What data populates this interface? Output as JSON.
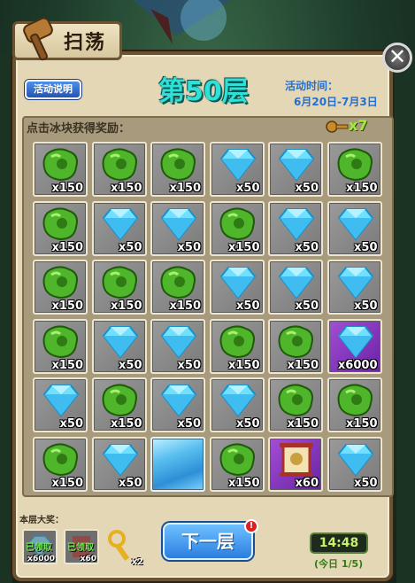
{
  "header": {
    "title": "扫荡",
    "close_label": "✕"
  },
  "info_button": "活动说明",
  "floor_title": "第50层",
  "event": {
    "label": "活动时间：",
    "dates": "6月20日-7月3日"
  },
  "instructions": "点击冰块获得奖励：",
  "keys": {
    "count": "x7"
  },
  "grid": [
    [
      {
        "type": "jade",
        "qty": "x150"
      },
      {
        "type": "jade",
        "qty": "x150"
      },
      {
        "type": "jade",
        "qty": "x150"
      },
      {
        "type": "diamond",
        "qty": "x50"
      },
      {
        "type": "diamond",
        "qty": "x50"
      },
      {
        "type": "jade",
        "qty": "x150"
      }
    ],
    [
      {
        "type": "jade",
        "qty": "x150"
      },
      {
        "type": "diamond",
        "qty": "x50"
      },
      {
        "type": "diamond",
        "qty": "x50"
      },
      {
        "type": "jade",
        "qty": "x150"
      },
      {
        "type": "diamond",
        "qty": "x50"
      },
      {
        "type": "diamond",
        "qty": "x50"
      }
    ],
    [
      {
        "type": "jade",
        "qty": "x150"
      },
      {
        "type": "jade",
        "qty": "x150"
      },
      {
        "type": "jade",
        "qty": "x150"
      },
      {
        "type": "diamond",
        "qty": "x50"
      },
      {
        "type": "diamond",
        "qty": "x50"
      },
      {
        "type": "diamond",
        "qty": "x50"
      }
    ],
    [
      {
        "type": "jade",
        "qty": "x150"
      },
      {
        "type": "diamond",
        "qty": "x50"
      },
      {
        "type": "diamond",
        "qty": "x50"
      },
      {
        "type": "jade",
        "qty": "x150"
      },
      {
        "type": "jade",
        "qty": "x150"
      },
      {
        "type": "diamond",
        "qty": "x6000",
        "bg": "purple"
      }
    ],
    [
      {
        "type": "diamond",
        "qty": "x50"
      },
      {
        "type": "jade",
        "qty": "x150"
      },
      {
        "type": "diamond",
        "qty": "x50"
      },
      {
        "type": "diamond",
        "qty": "x50"
      },
      {
        "type": "jade",
        "qty": "x150"
      },
      {
        "type": "jade",
        "qty": "x150"
      }
    ],
    [
      {
        "type": "jade",
        "qty": "x150"
      },
      {
        "type": "diamond",
        "qty": "x50"
      },
      {
        "type": "ice",
        "qty": ""
      },
      {
        "type": "jade",
        "qty": "x150"
      },
      {
        "type": "scroll",
        "qty": "x60",
        "bg": "purple"
      },
      {
        "type": "diamond",
        "qty": "x50"
      }
    ]
  ],
  "big_prize": {
    "label": "本层大奖：",
    "items": [
      {
        "status": "已领取",
        "qty": "x6000",
        "icon": "diamond-icon"
      },
      {
        "status": "已领取",
        "qty": "x60",
        "icon": "scroll-icon"
      }
    ],
    "key_qty": "x2"
  },
  "next_button": "下一层",
  "alert_badge": "!",
  "timer": "14:48",
  "today": "(今日 1/5)",
  "colors": {
    "floor_title": "#2fe0d6",
    "event_text": "#1f6fd6",
    "keys": "#a6e93f",
    "timer": "#c7f06a",
    "panel": "#e4d7b6"
  }
}
